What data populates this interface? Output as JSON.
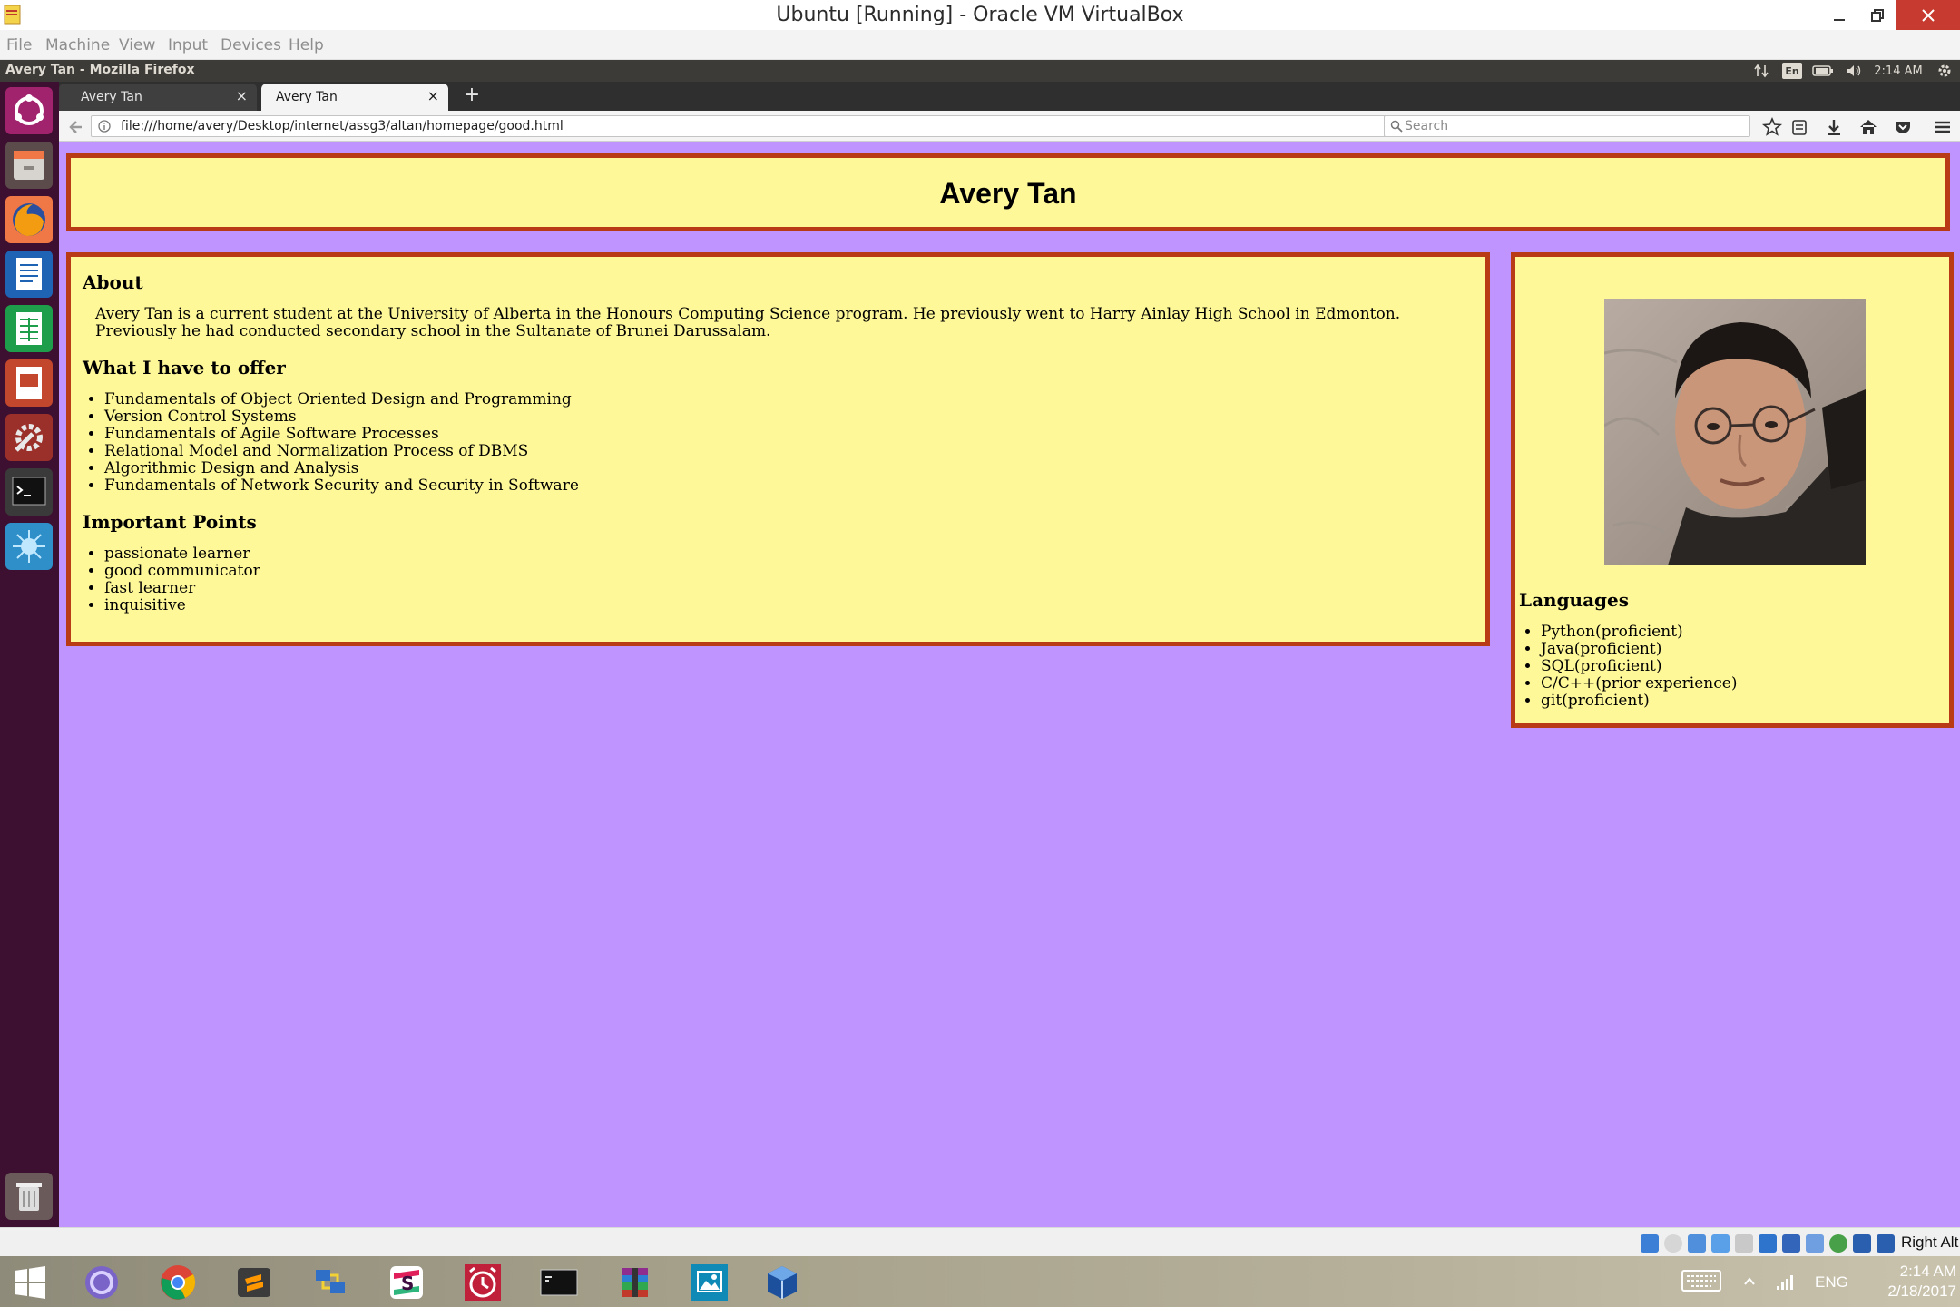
{
  "vbox": {
    "title": "Ubuntu [Running] - Oracle VM VirtualBox",
    "menu": [
      "File",
      "Machine",
      "View",
      "Input",
      "Devices",
      "Help"
    ],
    "host_key": "Right Alt"
  },
  "ubuntu": {
    "panel_title": "Avery Tan - Mozilla Firefox",
    "panel_lang": "En",
    "panel_time": "2:14 AM",
    "launcher": [
      "dash-home",
      "files",
      "firefox",
      "writer",
      "calc",
      "impress",
      "settings",
      "terminal",
      "unknown-app",
      "trash"
    ]
  },
  "firefox": {
    "tabs": [
      {
        "label": "Avery Tan",
        "active": false
      },
      {
        "label": "Avery Tan",
        "active": true
      }
    ],
    "url": "file:///home/avery/Desktop/internet/assg3/altan/homepage/good.html",
    "search_placeholder": "Search"
  },
  "page": {
    "title": "Avery Tan",
    "about_heading": "About",
    "about_text": "Avery Tan is a current student at the University of Alberta in the Honours Computing Science program. He previously went to Harry Ainlay High School in Edmonton. Previously he had conducted secondary school in the Sultanate of Brunei Darussalam.",
    "offer_heading": "What I have to offer",
    "offer_items": [
      "Fundamentals of Object Oriented Design and Programming",
      "Version Control Systems",
      "Fundamentals of Agile Software Processes",
      "Relational Model and Normalization Process of DBMS",
      "Algorithmic Design and Analysis",
      "Fundamentals of Network Security and Security in Software"
    ],
    "points_heading": "Important Points",
    "points_items": [
      "passionate learner",
      "good communicator",
      "fast learner",
      "inquisitive"
    ],
    "languages_heading": "Languages",
    "languages_items": [
      "Python(proficient)",
      "Java(proficient)",
      "SQL(proficient)",
      "C/C++(prior experience)",
      "git(proficient)"
    ]
  },
  "taskbar": {
    "apps": [
      "windows-start",
      "cortana",
      "chrome",
      "sublime-text",
      "network",
      "slack",
      "alarm-clock",
      "command-prompt",
      "winrar",
      "photos",
      "virtualbox"
    ],
    "language": "ENG",
    "time": "2:14 AM",
    "date": "2/18/2017"
  },
  "colors": {
    "page_bg": "#bf94fe",
    "box_bg": "#fff899",
    "box_border": "#b83b16"
  }
}
